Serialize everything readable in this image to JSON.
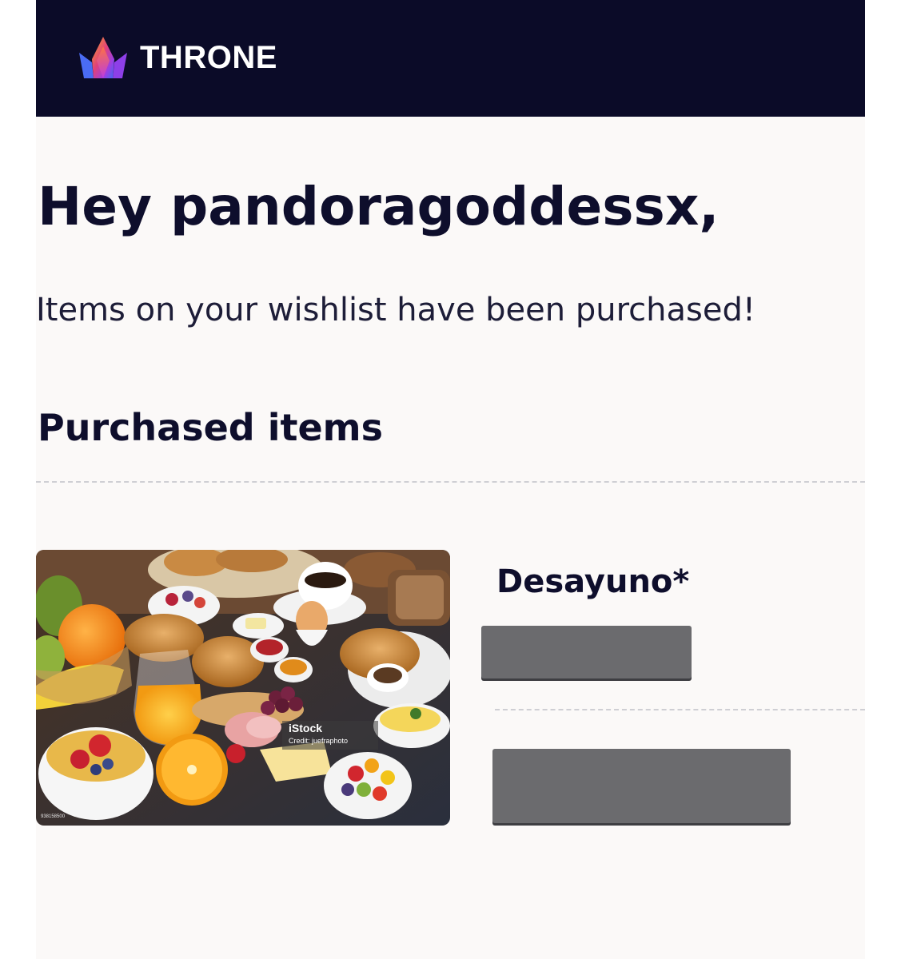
{
  "header": {
    "brand_name": "THRONE",
    "logo_icon": "crown-icon",
    "background_color": "#0b0b28"
  },
  "body": {
    "greeting": "Hey pandoragoddessx,",
    "message": "Items on your wishlist have been purchased!",
    "section_title": "Purchased items"
  },
  "purchased_items": [
    {
      "name": "Desayuno*",
      "image": {
        "watermark_title": "iStock",
        "watermark_credit": "Credit: juefraphoto",
        "stock_id": "938158500"
      },
      "redacted_fields": 2
    }
  ],
  "colors": {
    "text_dark": "#0e0e2c",
    "page_background": "#fbf9f8",
    "redaction": "#6b6b6e",
    "logo_gradient": [
      "#f5a623",
      "#e0407a",
      "#7b3fe4",
      "#3b6cf0"
    ]
  }
}
